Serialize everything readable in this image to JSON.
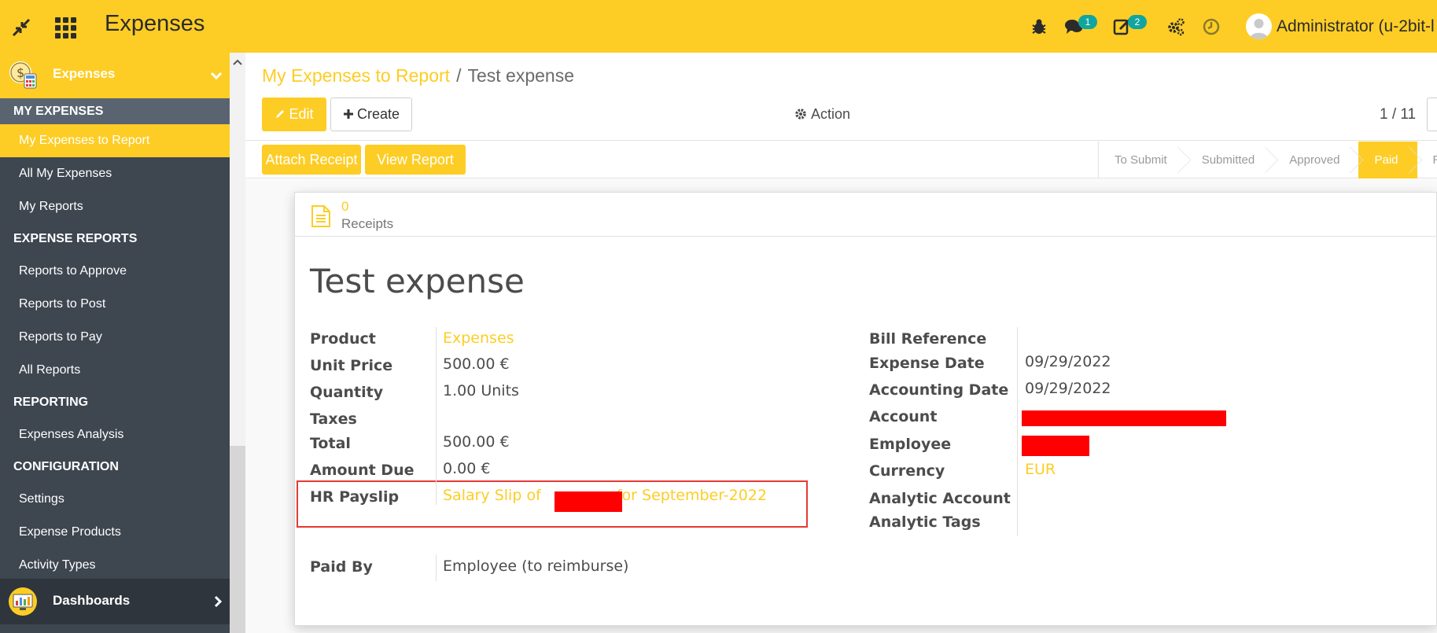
{
  "topbar": {
    "app_title": "Expenses",
    "messages_count": "1",
    "activities_count": "2",
    "user": "Administrator (u-2bit-l",
    "accent_color": "#fdcd25"
  },
  "sidebar": {
    "app_label": "Expenses",
    "sections": [
      {
        "label": "MY EXPENSES",
        "items": [
          "My Expenses to Report",
          "All My Expenses",
          "My Reports"
        ]
      },
      {
        "label": "EXPENSE REPORTS",
        "items": [
          "Reports to Approve",
          "Reports to Post",
          "Reports to Pay",
          "All Reports"
        ]
      },
      {
        "label": "REPORTING",
        "items": [
          "Expenses Analysis"
        ]
      },
      {
        "label": "CONFIGURATION",
        "items": [
          "Settings",
          "Expense Products",
          "Activity Types"
        ]
      }
    ],
    "dashboards_label": "Dashboards"
  },
  "breadcrumb": {
    "parent": "My Expenses to Report",
    "separator": "/",
    "current": "Test expense"
  },
  "toolbar": {
    "edit": "Edit",
    "create": "Create",
    "action": "Action",
    "pager": "1 / 11"
  },
  "statusbar": {
    "attach_receipt": "Attach Receipt",
    "view_report": "View Report",
    "stages": [
      "To Submit",
      "Submitted",
      "Approved",
      "Paid",
      "R"
    ],
    "current_stage": "Paid"
  },
  "form": {
    "receipts_count": "0",
    "receipts_label": "Receipts",
    "title": "Test expense",
    "left": {
      "product_label": "Product",
      "product_value": "Expenses",
      "unit_price_label": "Unit Price",
      "unit_price_value": "500.00 €",
      "quantity_label": "Quantity",
      "quantity_value": "1.00 Units",
      "taxes_label": "Taxes",
      "total_label": "Total",
      "total_value": "500.00 €",
      "amount_due_label": "Amount Due",
      "amount_due_value": "0.00 €",
      "payslip_label": "HR Payslip",
      "payslip_prefix": "Salary Slip of",
      "payslip_suffix": "for September-2022",
      "paid_by_label": "Paid By",
      "paid_by_value": "Employee (to reimburse)"
    },
    "right": {
      "bill_ref_label": "Bill Reference",
      "expense_date_label": "Expense Date",
      "expense_date_value": "09/29/2022",
      "accounting_date_label": "Accounting Date",
      "accounting_date_value": "09/29/2022",
      "account_label": "Account",
      "employee_label": "Employee",
      "currency_label": "Currency",
      "currency_value": "EUR",
      "analytic_account_label": "Analytic Account",
      "analytic_tags_label": "Analytic Tags"
    }
  }
}
